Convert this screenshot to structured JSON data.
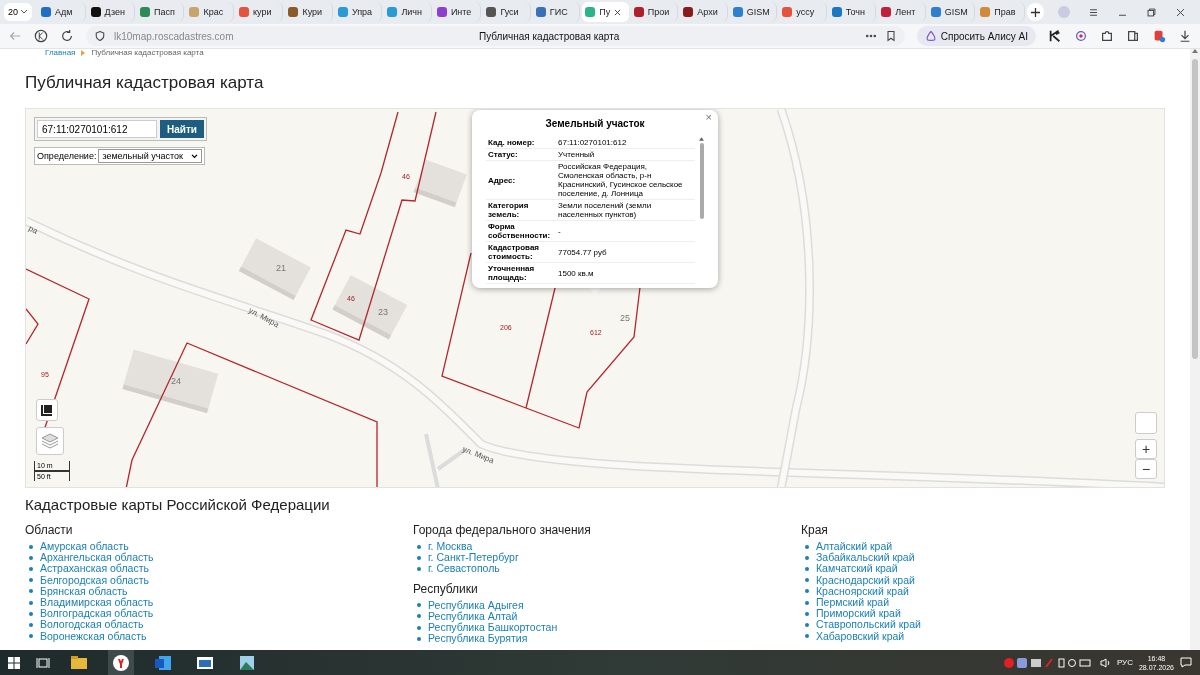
{
  "browser": {
    "workspace": "20",
    "tabs": [
      {
        "label": "Адм",
        "selected": false,
        "color": "#1f6fc5"
      },
      {
        "label": "Дзен",
        "selected": false,
        "color": "#111111"
      },
      {
        "label": "Пасп",
        "selected": false,
        "color": "#2e8b57"
      },
      {
        "label": "Крас",
        "selected": false,
        "color": "#c9a46a"
      },
      {
        "label": "кури",
        "selected": false,
        "color": "#e5533c"
      },
      {
        "label": "Кури",
        "selected": false,
        "color": "#8a5a2b"
      },
      {
        "label": "Упра",
        "selected": false,
        "color": "#2a9ad6"
      },
      {
        "label": "Личн",
        "selected": false,
        "color": "#2a9ad6"
      },
      {
        "label": "Инте",
        "selected": false,
        "color": "#8e3fd1"
      },
      {
        "label": "Гуси",
        "selected": false,
        "color": "#555555"
      },
      {
        "label": "ГИС",
        "selected": false,
        "color": "#3b6fb6"
      },
      {
        "label": "Пу",
        "selected": true,
        "color": "#2bb38a"
      },
      {
        "label": "Прои",
        "selected": false,
        "color": "#b0202a"
      },
      {
        "label": "Архи",
        "selected": false,
        "color": "#8b1a1a"
      },
      {
        "label": "GISM",
        "selected": false,
        "color": "#2f7fd1"
      },
      {
        "label": "уссу",
        "selected": false,
        "color": "#e5533c"
      },
      {
        "label": "Точн",
        "selected": false,
        "color": "#1a78c2"
      },
      {
        "label": "Лент",
        "selected": false,
        "color": "#c0203a"
      },
      {
        "label": "GISM",
        "selected": false,
        "color": "#2f7fd1"
      },
      {
        "label": "Прав",
        "selected": false,
        "color": "#d08a3a"
      }
    ],
    "address": "lk10map.roscadastres.com",
    "page_title": "Публичная кадастровая карта",
    "assistant_button": "Спросить Алису AI"
  },
  "breadcrumb": [
    "Главная",
    "Публичная кадастровая карта"
  ],
  "heading": "Публичная кадастровая карта",
  "map": {
    "search": {
      "value": "67:11:0270101:612",
      "button": "Найти"
    },
    "definition": {
      "label": "Определение:",
      "value": "земельный участок"
    },
    "labels": [
      {
        "kind": "street",
        "text": "ра"
      },
      {
        "kind": "building",
        "text": "21"
      },
      {
        "kind": "parcel",
        "text": "46"
      },
      {
        "kind": "parcel",
        "text": "46"
      },
      {
        "kind": "building",
        "text": "23"
      },
      {
        "kind": "street",
        "text": "ул. Мира"
      },
      {
        "kind": "parcel",
        "text": "95"
      },
      {
        "kind": "building",
        "text": "24"
      },
      {
        "kind": "parcel",
        "text": "206"
      },
      {
        "kind": "parcel",
        "text": "612"
      },
      {
        "kind": "building",
        "text": "25"
      },
      {
        "kind": "street",
        "text": "ул. Мира"
      }
    ],
    "popup": {
      "title": "Земельный участок",
      "close": "×",
      "rows": [
        {
          "label": "Кад. номер:",
          "value": "67:11:0270101:612"
        },
        {
          "label": "Статус:",
          "value": "Учтенный"
        },
        {
          "label": "Адрес:",
          "value": "Российская Федерация, Смоленская область, р-н Краснинский, Гусинское сельское поселение, д. Лонница"
        },
        {
          "label": "Категория земель:",
          "value": "Земли поселений (земли населенных пунктов)"
        },
        {
          "label": "Форма собственности:",
          "value": "-"
        },
        {
          "label": "Кадастровая стоимость:",
          "value": "77054.77 руб"
        },
        {
          "label": "Уточненная площадь:",
          "value": "1500 кв.м"
        }
      ]
    },
    "scale": [
      "10 m",
      "50 ft"
    ],
    "zoom": [
      "+",
      "−"
    ]
  },
  "directory": {
    "title": "Кадастровые карты Российской Федерации",
    "columns": [
      {
        "groups": [
          {
            "title": "Области",
            "items": [
              "Амурская область",
              "Архангельская область",
              "Астраханская область",
              "Белгородская область",
              "Брянская область",
              "Владимирская область",
              "Волгоградская область",
              "Вологодская область",
              "Воронежская область"
            ]
          }
        ]
      },
      {
        "groups": [
          {
            "title": "Города федерального значения",
            "items": [
              "г. Москва",
              "г. Санкт-Петербург",
              "г. Севастополь"
            ]
          },
          {
            "title": "Республики",
            "items": [
              "Республика Адыгея",
              "Республика Алтай",
              "Республика Башкортостан",
              "Республика Бурятия"
            ]
          }
        ]
      },
      {
        "groups": [
          {
            "title": "Края",
            "items": [
              "Алтайский край",
              "Забайкальский край",
              "Камчатский край",
              "Краснодарский край",
              "Красноярский край",
              "Пермский край",
              "Приморский край",
              "Ставропольский край",
              "Хабаровский край"
            ]
          }
        ]
      }
    ]
  },
  "taskbar": {
    "language": "РУС",
    "time": "16:48",
    "date": "28.07.2026"
  }
}
